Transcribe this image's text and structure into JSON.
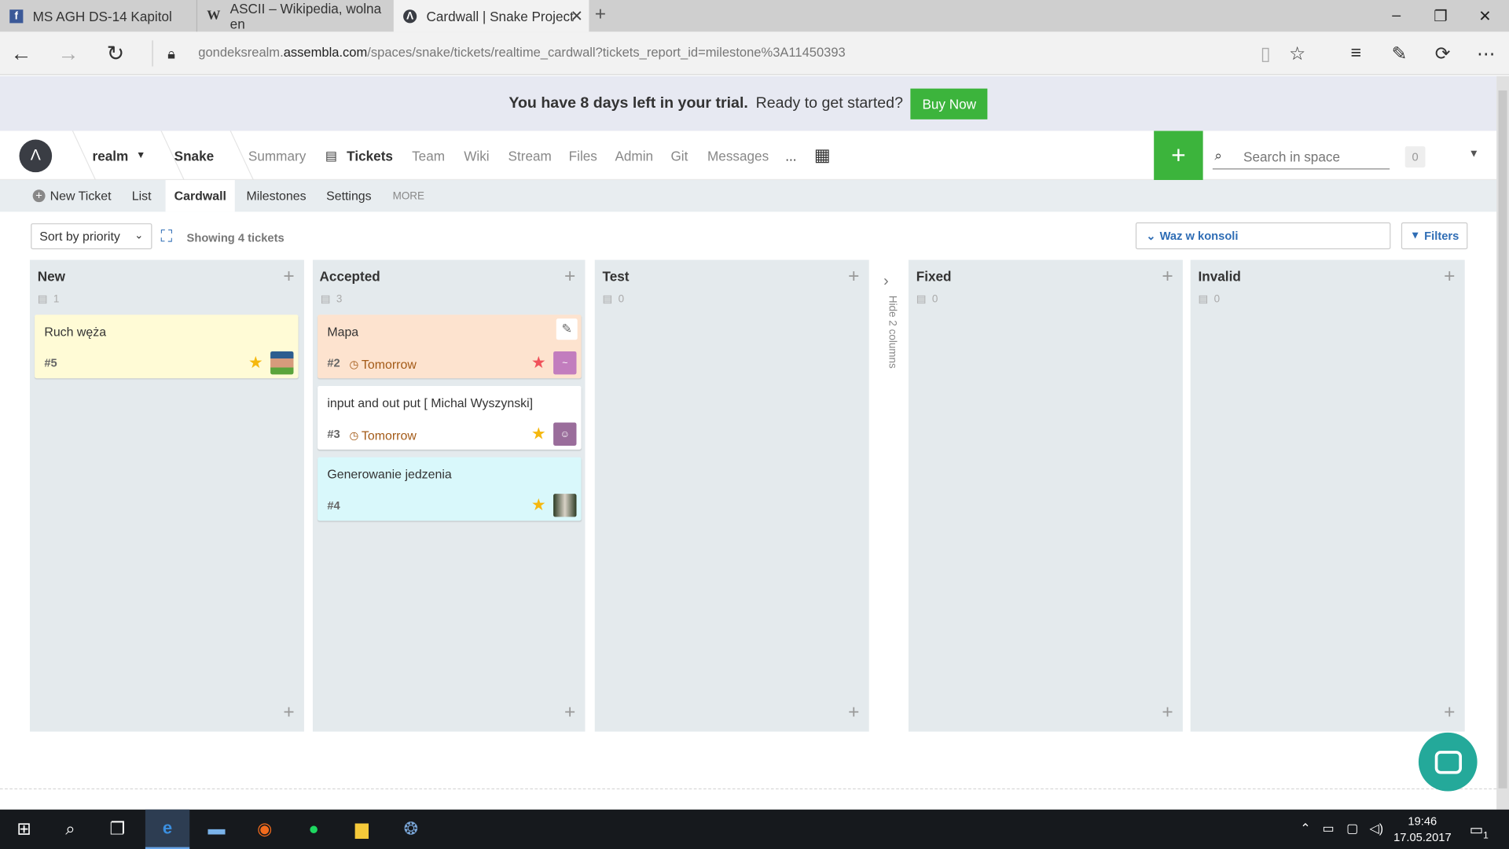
{
  "browser": {
    "tabs": [
      {
        "label": "MS AGH DS-14 Kapitol",
        "favicon": "f"
      },
      {
        "label": "ASCII – Wikipedia, wolna en",
        "favicon": "W"
      },
      {
        "label": "Cardwall | Snake Project",
        "favicon": "Λ"
      }
    ],
    "url_prefix": "gondeksrealm.",
    "url_domain": "assembla.com",
    "url_path": "/spaces/snake/tickets/realtime_cardwall?tickets_report_id=milestone%3A11450393"
  },
  "trial": {
    "message": "You have 8 days left in your trial.",
    "prompt": "Ready to get started?",
    "buy_label": "Buy Now"
  },
  "nav": {
    "realm": "realm",
    "space": "Snake",
    "links": [
      "Summary",
      "Tickets",
      "Team",
      "Wiki",
      "Stream",
      "Files",
      "Admin",
      "Git",
      "Messages",
      "..."
    ],
    "active_link": "Tickets",
    "search_placeholder": "Search in space",
    "notification_count": "0"
  },
  "subnav": {
    "new_ticket": "New Ticket",
    "links": [
      "List",
      "Cardwall",
      "Milestones",
      "Settings"
    ],
    "active": "Cardwall",
    "more": "MORE"
  },
  "toolbar": {
    "sort_label": "Sort by priority",
    "showing": "Showing 4 tickets",
    "milestone": "Waz w konsoli",
    "filters": "Filters"
  },
  "hidden_columns_label": "Hide 2 columns",
  "columns": [
    {
      "title": "New",
      "count": "1",
      "cards": [
        {
          "title": "Ruch węża",
          "number": "#5",
          "due": "",
          "star_color": "#f5b80f",
          "bg": "#fffbd6",
          "avatar": "photo-green"
        }
      ]
    },
    {
      "title": "Accepted",
      "count": "3",
      "cards": [
        {
          "title": "Mapa",
          "number": "#2",
          "due": "Tomorrow",
          "star_color": "#f0525b",
          "bg": "#fde3cf",
          "avatar": "purple-face"
        },
        {
          "title": "input and out put [ Michal Wyszynski]",
          "number": "#3",
          "due": "Tomorrow",
          "star_color": "#f5b80f",
          "bg": "#ffffff",
          "avatar": "purple-face-2"
        },
        {
          "title": "Generowanie jedzenia",
          "number": "#4",
          "due": "",
          "star_color": "#f5b80f",
          "bg": "#d9f8fb",
          "avatar": "photo-dark"
        }
      ]
    },
    {
      "title": "Test",
      "count": "0",
      "cards": []
    },
    {
      "title": "Fixed",
      "count": "0",
      "cards": []
    },
    {
      "title": "Invalid",
      "count": "0",
      "cards": []
    }
  ],
  "taskbar": {
    "time": "19:46",
    "date": "17.05.2017",
    "notification": "1"
  },
  "colors": {
    "accent_green": "#3cb43c",
    "link_blue": "#2f6db5",
    "column_bg": "#e4eaed"
  }
}
